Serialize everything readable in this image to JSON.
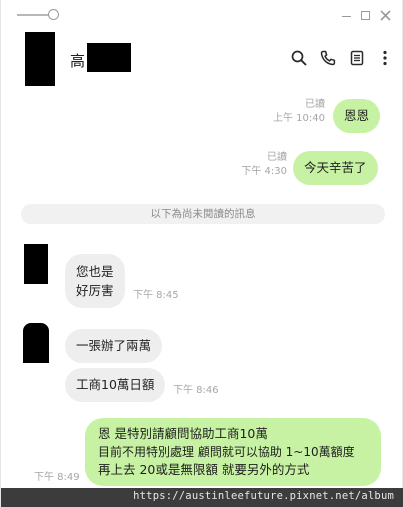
{
  "header": {
    "contact_name_visible": "高",
    "icons": [
      "search-icon",
      "phone-icon",
      "notes-icon",
      "more-icon"
    ]
  },
  "messages_sent": [
    {
      "text": "恩恩",
      "read": "已讀",
      "time": "上午 10:40"
    },
    {
      "text": "今天辛苦了",
      "read": "已讀",
      "time": "下午 4:30"
    }
  ],
  "divider": {
    "text": "以下為尚未閱讀的訊息"
  },
  "messages_received": [
    {
      "lines": [
        "您也是",
        "好厉害"
      ],
      "time": "下午 8:45"
    },
    {
      "text": "一張辦了兩萬",
      "time": ""
    },
    {
      "text": "工商10萬日額",
      "time": "下午 8:46"
    }
  ],
  "last_sent": {
    "lines": [
      "恩 是特別請顧問協助工商10萬",
      "目前不用特別處理 顧問就可以協助 1~10萬額度",
      "再上去 20或是無限額 就要另外的方式"
    ],
    "time": "下午 8:49"
  },
  "watermark": "https://austinleefuture.pixnet.net/album",
  "colors": {
    "sent_bubble": "#c7f2a4",
    "received_bubble": "#eeeeee",
    "meta_text": "#a6a6a6"
  }
}
